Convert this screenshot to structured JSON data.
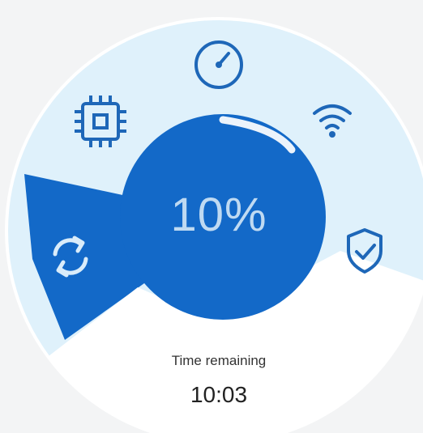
{
  "progress": {
    "percent_text": "10%",
    "value_percent": 10
  },
  "timer": {
    "label": "Time remaining",
    "value": "10:03"
  },
  "icons": {
    "top": "speedometer-icon",
    "top_left": "processor-chip-icon",
    "top_right": "wifi-icon",
    "left": "sync-icon",
    "right": "shield-check-icon"
  },
  "colors": {
    "accent": "#1369c8",
    "dial_background": "#dff1fb",
    "lower_area": "#ffffff",
    "icon_stroke": "#1e67b8",
    "percent_text": "#bfdaf2"
  }
}
